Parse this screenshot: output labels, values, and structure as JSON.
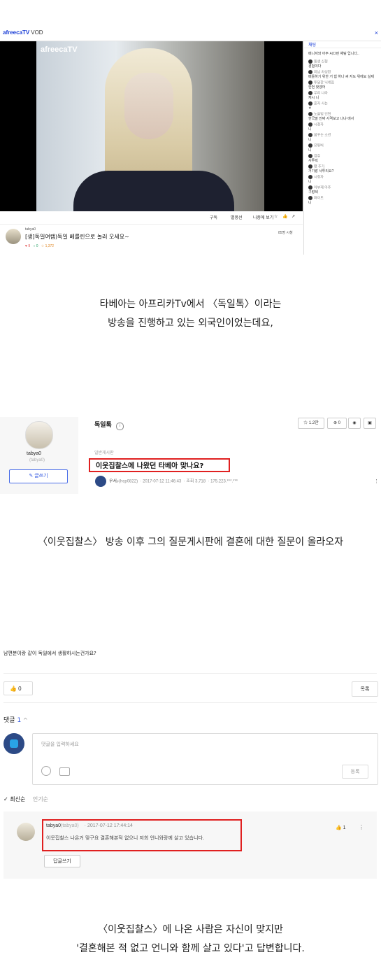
{
  "panel1": {
    "logo": "afreecaTV",
    "logo_suffix": "VOD",
    "close": "×",
    "video_watermark": "afreecaTV",
    "controls": [
      "구독",
      "별풍선",
      "나중에 보기",
      "☆",
      "👍",
      "↗"
    ],
    "chat_header": "채팅",
    "chat_notice": "매니저와 아주 씨끄런 채팅 입니다..",
    "chat_messages": [
      {
        "user": "동생 신청",
        "text": "경험이다"
      },
      {
        "user": "미남 차성환",
        "text": "배틀하기 위한 거 힘 하나 써 지도 위에요 실제"
      },
      {
        "user": "투덜한 닉네임",
        "text": "한번 찾겠어"
      },
      {
        "user": "우리 나라",
        "text": "케시 니"
      },
      {
        "user": "혼자 사는",
        "text": "ㅎ"
      },
      {
        "user": "노을빛 인연",
        "text": "한국말 진짜 사격보고 나냐 에서"
      },
      {
        "user": "시청자",
        "text": "니"
      },
      {
        "user": "꿈꾸는 소년",
        "text": "니"
      },
      {
        "user": "유튜버",
        "text": "니"
      },
      {
        "user": "깜쥬",
        "text": "사투릭"
      },
      {
        "user": "팬 추가",
        "text": "거기랑 사투리요?"
      },
      {
        "user": "시청자",
        "text": "니"
      },
      {
        "user": "아부제 아주",
        "text": "구렁텍"
      },
      {
        "user": "화이트",
        "text": "니"
      }
    ],
    "channel": "tabya0",
    "video_title": "[생]독일여캠)독일 베를린으로 놀러 오세요~",
    "stats": [
      "9",
      "0",
      "1,372"
    ],
    "ago": "85명 시청"
  },
  "caption1": [
    "타베아는 아프리카Tv에서 〈독일톡〉이라는",
    "방송을 진행하고 있는 외국인이었는데요,"
  ],
  "panel2": {
    "profile_name": "tabya0",
    "profile_id": "(tabya0)",
    "write_label": "✎ 글쓰기",
    "board_name": "독일톡",
    "buttons": [
      "☆ 1.2만",
      "⊕ 0",
      "◉",
      "▣"
    ],
    "category": "일반게시판",
    "post_title": "이웃집찰스에 나왔던 타베아 맞나요?",
    "author": "우서♪",
    "author_id": "(hcp0822)",
    "date": "2017-07-12 11:46:43",
    "views": "조회 3,718",
    "ip": "175.223.***.***",
    "kebab": "⋮"
  },
  "caption2": [
    "〈이웃집찰스〉 방송 이후 그의 질문게시판에 결혼에 대한 질문이 올라오자"
  ],
  "panel3": {
    "question": "남편분이랑 같이 독일에서 생활하시는건가요?",
    "like_count": "👍 0",
    "list_label": "목록",
    "comment_label": "댓글",
    "comment_count": "1",
    "comment_chevron": "^",
    "placeholder": "댓글을 입력하세요",
    "register": "등록",
    "sort_latest": "✓ 최신순",
    "sort_popular": "인기순",
    "reply_user": "tabya0",
    "reply_user_id": "(tabya0)",
    "reply_date": "2017-07-12 17:44:14",
    "reply_text": "이웃집찰스 나온거 맞구요 결혼해본적 없으니 저희 언니와랑께 살고 있습니다.",
    "reply_button": "답글쓰기",
    "reply_likes": "👍 1",
    "reply_kebab": "⋮"
  },
  "caption3": [
    "〈이웃집찰스〉에 나온 사람은 자신이 맞지만",
    "'결혼해본 적 없고 언니와 함께 살고 있다'고 답변합니다."
  ]
}
